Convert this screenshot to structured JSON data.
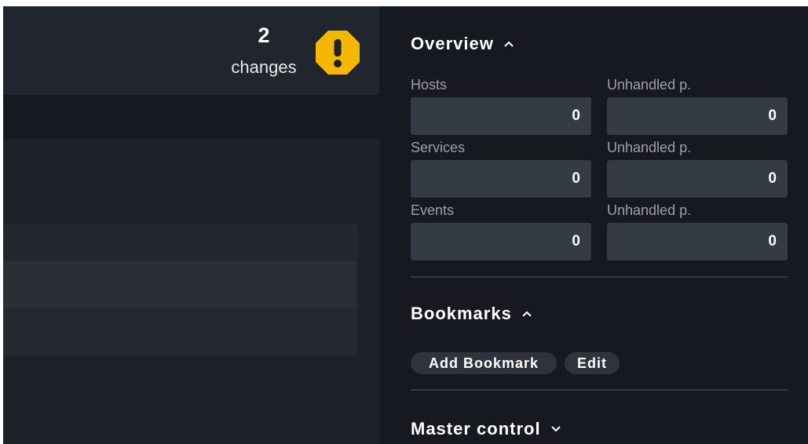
{
  "header": {
    "changes_count": "2",
    "changes_label": "changes",
    "warning_icon": "exclamation-octagon-icon",
    "warning_color": "#f5b800"
  },
  "overview": {
    "title": "Overview",
    "expanded": true,
    "stats": [
      {
        "label": "Hosts",
        "value": "0",
        "unhandled_label": "Unhandled p.",
        "unhandled_value": "0"
      },
      {
        "label": "Services",
        "value": "0",
        "unhandled_label": "Unhandled p.",
        "unhandled_value": "0"
      },
      {
        "label": "Events",
        "value": "0",
        "unhandled_label": "Unhandled p.",
        "unhandled_value": "0"
      }
    ]
  },
  "bookmarks": {
    "title": "Bookmarks",
    "expanded": true,
    "add_label": "Add Bookmark",
    "edit_label": "Edit"
  },
  "master_control": {
    "title": "Master control",
    "expanded": false
  },
  "colors": {
    "sidebar_bg": "#16191f",
    "main_bg": "#1e2127",
    "stat_box_bg": "#353b45",
    "pill_bg": "#2e333c"
  }
}
